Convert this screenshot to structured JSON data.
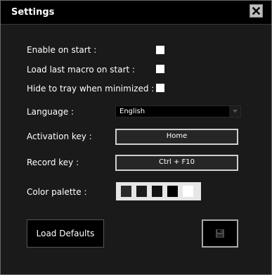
{
  "window": {
    "title": "Settings"
  },
  "settings": {
    "enable_on_start": {
      "label": "Enable on start :",
      "checked": false
    },
    "load_last_macro": {
      "label": "Load last macro on start :",
      "checked": false
    },
    "hide_to_tray": {
      "label": "Hide to tray when minimized :",
      "checked": false
    },
    "language": {
      "label": "Language :",
      "value": "English"
    },
    "activation_key": {
      "label": "Activation key :",
      "value": "Home"
    },
    "record_key": {
      "label": "Record key :",
      "value": "Ctrl + F10"
    },
    "color_palette": {
      "label": "Color palette :",
      "colors": [
        "#2a2a2a",
        "#1b1b1b",
        "#121212",
        "#000000",
        "#ffffff"
      ]
    }
  },
  "buttons": {
    "load_defaults": "Load Defaults"
  },
  "icons": {
    "close": "close-icon",
    "save": "floppy-disk-icon",
    "dropdown": "chevron-down-icon"
  }
}
